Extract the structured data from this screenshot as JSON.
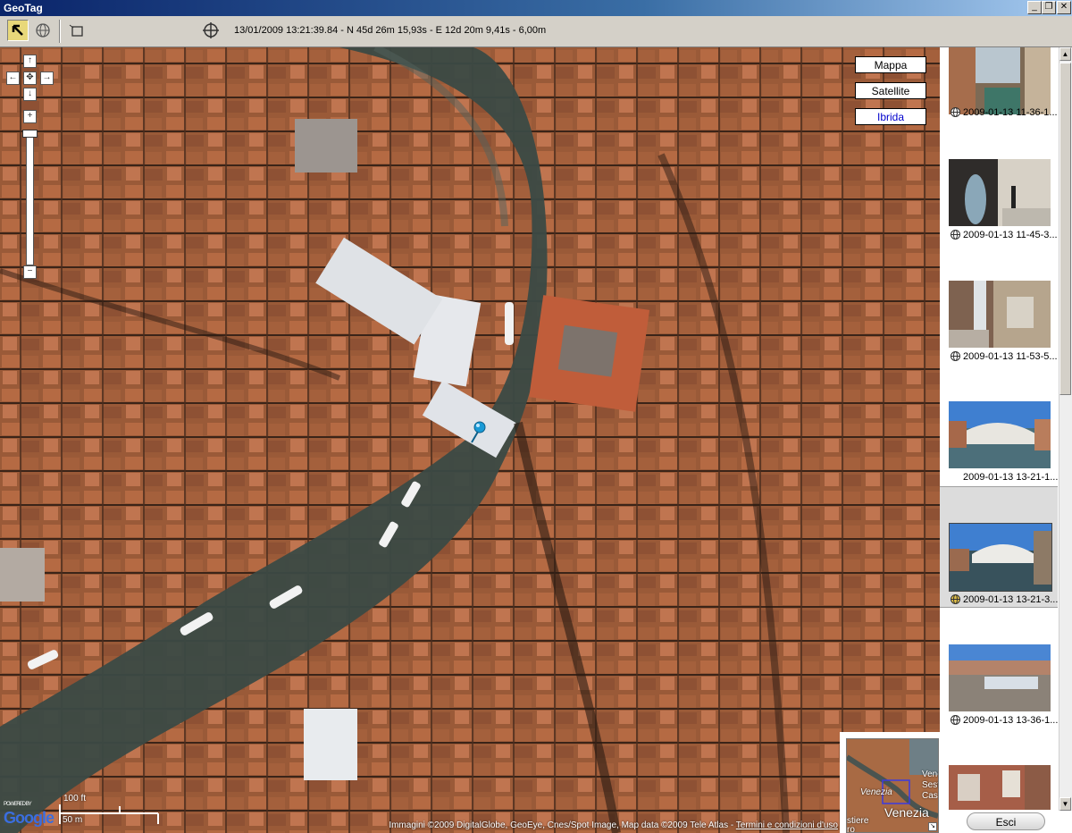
{
  "window": {
    "title": "GeoTag",
    "minimize": "_",
    "restore": "❐",
    "close": "✕"
  },
  "toolbar": {
    "coordinates": "13/01/2009 13:21:39.84 - N 45d 26m 15,93s - E 12d 20m 9,41s - 6,00m"
  },
  "map": {
    "type_buttons": [
      "Mappa",
      "Satellite",
      "Ibrida"
    ],
    "selected_type": "Ibrida",
    "nav": {
      "up": "↑",
      "down": "↓",
      "left": "←",
      "right": "→",
      "center": "✥",
      "zoom_in": "+",
      "zoom_out": "−"
    },
    "attribution": "Immagini ©2009 DigitalGlobe, GeoEye, Cnes/Spot Image, Map data ©2009 Tele Atlas - ",
    "terms_link": "Termini e condizioni d'uso",
    "logo": "Google",
    "logo_small": "POWERED BY",
    "scale_ft": "100 ft",
    "scale_m": "50 m",
    "overview": {
      "city": "Venezia",
      "labels": [
        "Venezia",
        "Vene",
        "Sest",
        "Cas",
        "stiere",
        "ro"
      ]
    }
  },
  "sidebar": {
    "photos": [
      {
        "caption": "2009-01-13 11-36-1...",
        "geotagged": true
      },
      {
        "caption": "2009-01-13 11-45-3...",
        "geotagged": true
      },
      {
        "caption": "2009-01-13 11-53-5...",
        "geotagged": true
      },
      {
        "caption": "2009-01-13 13-21-1...",
        "geotagged": false
      },
      {
        "caption": "2009-01-13 13-21-3...",
        "geotagged": true,
        "selected": true
      },
      {
        "caption": "2009-01-13 13-36-1...",
        "geotagged": true
      }
    ],
    "exit_button": "Esci"
  },
  "colors": {
    "title_bar": "#0a246a",
    "chrome": "#d4d0c8",
    "selected_map_type": "#0000cc",
    "pin": "#1a9ad6"
  }
}
